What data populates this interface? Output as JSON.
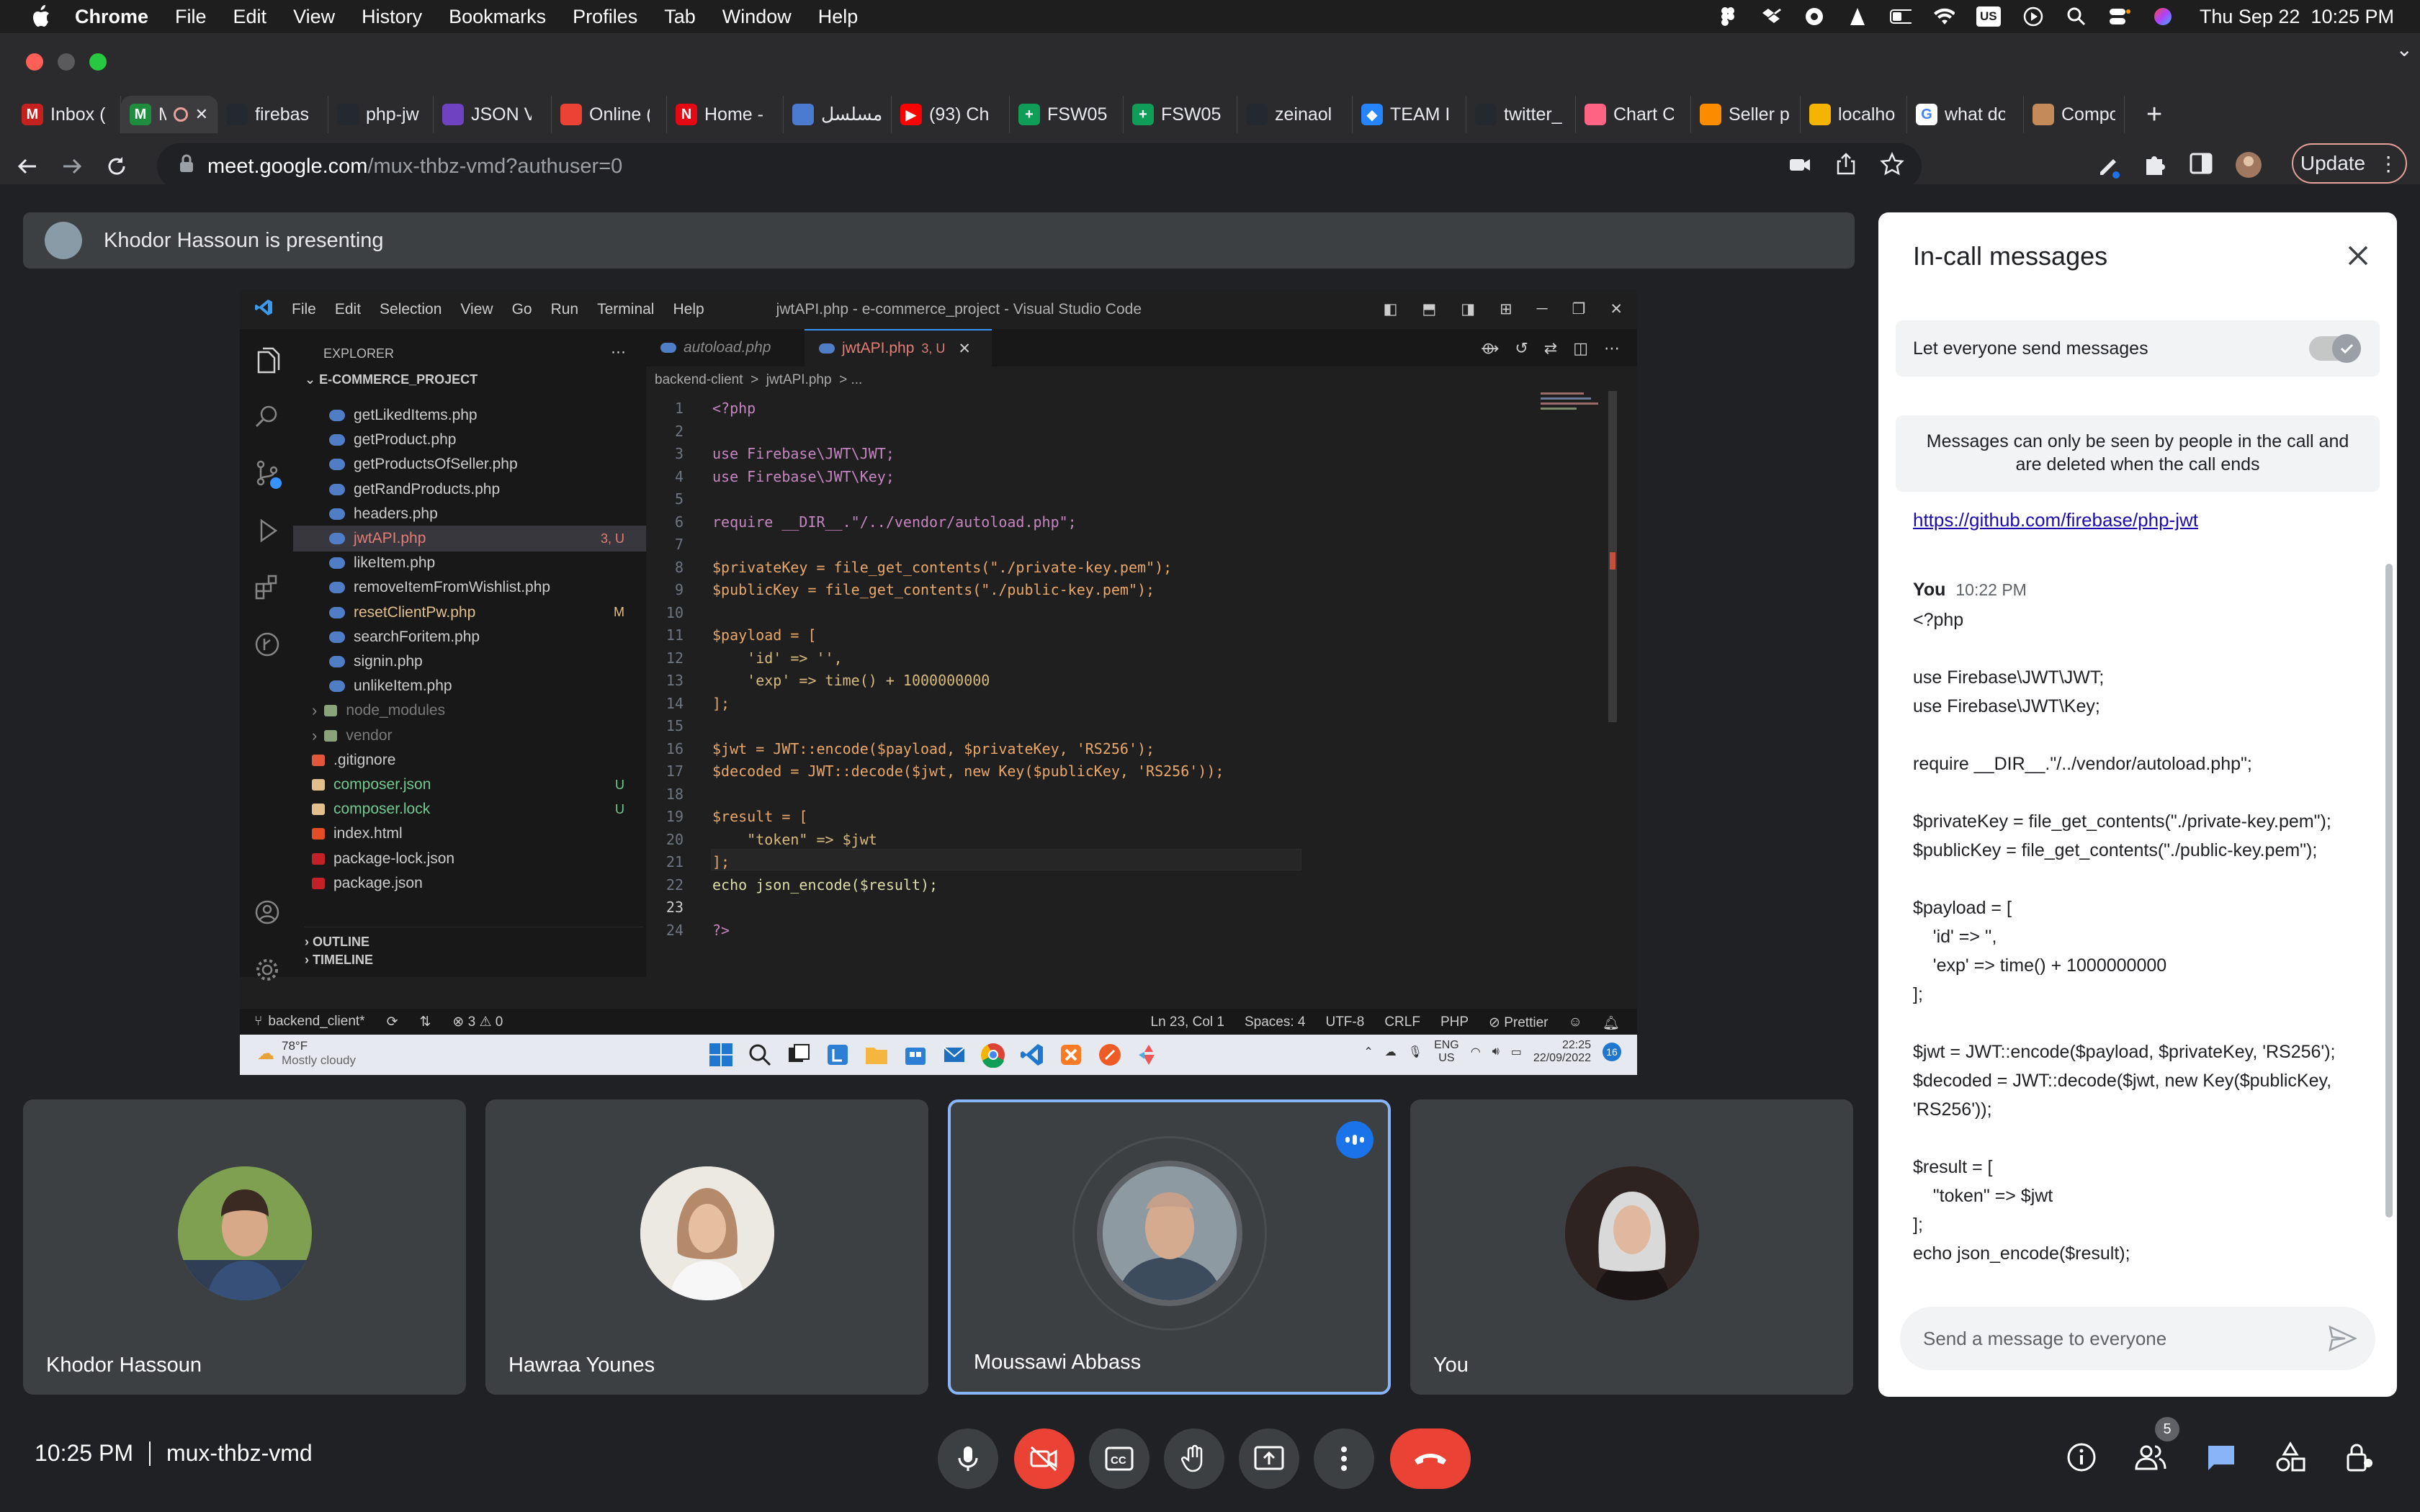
{
  "menubar": {
    "app": "Chrome",
    "items": [
      "File",
      "Edit",
      "View",
      "History",
      "Bookmarks",
      "Profiles",
      "Tab",
      "Window",
      "Help"
    ],
    "clock": "Thu Sep 22  10:25 PM",
    "input_source": "US"
  },
  "tabs": [
    {
      "label": "Inbox (",
      "fav": "M",
      "color": "#c5221f"
    },
    {
      "label": "M",
      "fav": "M",
      "color": "#1e8e3e",
      "active": true
    },
    {
      "label": "firebas",
      "fav": "",
      "color": "#24292f"
    },
    {
      "label": "php-jw",
      "fav": "",
      "color": "#24292f"
    },
    {
      "label": "JSON V",
      "fav": "",
      "color": "#6f42c1"
    },
    {
      "label": "Online (",
      "fav": "",
      "color": "#ea4335"
    },
    {
      "label": "Home -",
      "fav": "N",
      "color": "#e50914"
    },
    {
      "label": "مسلسل",
      "fav": "",
      "color": "#4a7bd0"
    },
    {
      "label": "(93) Ch",
      "fav": "▶",
      "color": "#ff0000"
    },
    {
      "label": "FSW05",
      "fav": "+",
      "color": "#0f9d58"
    },
    {
      "label": "FSW05",
      "fav": "+",
      "color": "#0f9d58"
    },
    {
      "label": "zeinaol",
      "fav": "",
      "color": "#24292f"
    },
    {
      "label": "TEAM I",
      "fav": "◆",
      "color": "#2684ff"
    },
    {
      "label": "twitter_",
      "fav": "",
      "color": "#24292f"
    },
    {
      "label": "Chart C",
      "fav": "",
      "color": "#ff6384"
    },
    {
      "label": "Seller p",
      "fav": "",
      "color": "#fb8c00"
    },
    {
      "label": "localho",
      "fav": "",
      "color": "#f4b400"
    },
    {
      "label": "what do",
      "fav": "G",
      "color": "#ffffff"
    },
    {
      "label": "Compo",
      "fav": "",
      "color": "#c58a5a"
    }
  ],
  "address": {
    "host": "meet.google.com",
    "path": "/mux-thbz-vmd?authuser=0"
  },
  "toolbar": {
    "update_label": "Update"
  },
  "presenting": {
    "text": "Khodor Hassoun is presenting"
  },
  "vscode": {
    "menus": [
      "File",
      "Edit",
      "Selection",
      "View",
      "Go",
      "Run",
      "Terminal",
      "Help"
    ],
    "window_title": "jwtAPI.php - e-commerce_project - Visual Studio Code",
    "explorer_label": "EXPLORER",
    "project": "E-COMMERCE_PROJECT",
    "files": [
      {
        "name": "getLikedItems.php",
        "type": "php"
      },
      {
        "name": "getProduct.php",
        "type": "php"
      },
      {
        "name": "getProductsOfSeller.php",
        "type": "php"
      },
      {
        "name": "getRandProducts.php",
        "type": "php"
      },
      {
        "name": "headers.php",
        "type": "php"
      },
      {
        "name": "jwtAPI.php",
        "type": "php",
        "badge": "3, U",
        "color": "#e37d77",
        "selected": true
      },
      {
        "name": "likeItem.php",
        "type": "php"
      },
      {
        "name": "removeItemFromWishlist.php",
        "type": "php"
      },
      {
        "name": "resetClientPw.php",
        "type": "php",
        "badge": "M",
        "color": "#e2c08d"
      },
      {
        "name": "searchForitem.php",
        "type": "php"
      },
      {
        "name": "signin.php",
        "type": "php"
      },
      {
        "name": "unlikeItem.php",
        "type": "php"
      },
      {
        "name": "node_modules",
        "type": "folder",
        "color": "#7a7a7a",
        "chev": true
      },
      {
        "name": "vendor",
        "type": "folder",
        "color": "#7a7a7a",
        "chev": true
      },
      {
        "name": ".gitignore",
        "type": "git"
      },
      {
        "name": "composer.json",
        "type": "json",
        "badge": "U",
        "color": "#73c991"
      },
      {
        "name": "composer.lock",
        "type": "json",
        "badge": "U",
        "color": "#73c991"
      },
      {
        "name": "index.html",
        "type": "html"
      },
      {
        "name": "package-lock.json",
        "type": "npm"
      },
      {
        "name": "package.json",
        "type": "npm"
      }
    ],
    "outline_label": "OUTLINE",
    "timeline_label": "TIMELINE",
    "tab1": "autoload.php",
    "tab2": "jwtAPI.php",
    "tab2_badge": "3, U",
    "breadcrumb": "backend-client  >  jwtAPI.php  > ...",
    "code": [
      "<?php",
      "",
      "use Firebase\\JWT\\JWT;",
      "use Firebase\\JWT\\Key;",
      "",
      "require __DIR__.\"/../vendor/autoload.php\";",
      "",
      "$privateKey = file_get_contents(\"./private-key.pem\");",
      "$publicKey = file_get_contents(\"./public-key.pem\");",
      "",
      "$payload = [",
      "    'id' => '',",
      "    'exp' => time() + 1000000000",
      "];",
      "",
      "$jwt = JWT::encode($payload, $privateKey, 'RS256');",
      "$decoded = JWT::decode($jwt, new Key($publicKey, 'RS256'));",
      "",
      "$result = [",
      "    \"token\" => $jwt",
      "];",
      "echo json_encode($result);",
      "",
      "?>"
    ],
    "status": {
      "branch": "backend_client*",
      "problems": "⊗ 3 ⚠ 0",
      "position": "Ln 23, Col 1",
      "spaces": "Spaces: 4",
      "encoding": "UTF-8",
      "eol": "CRLF",
      "lang": "PHP",
      "prettier": "Prettier"
    },
    "taskbar": {
      "temp": "78°F",
      "weather": "Mostly cloudy",
      "lang": "ENG",
      "region": "US",
      "time": "22:25",
      "date": "22/09/2022",
      "notif": "16"
    }
  },
  "participants": [
    {
      "name": "Khodor Hassoun",
      "bg": "#6b8f3e"
    },
    {
      "name": "Hawraa Younes",
      "bg": "#e8e2da"
    },
    {
      "name": "Moussawi Abbass",
      "bg": "#7e8a93",
      "speaking": true
    },
    {
      "name": "You",
      "bg": "#3b2d2a"
    }
  ],
  "bottom": {
    "time": "10:25 PM",
    "code": "mux-thbz-vmd",
    "people_count": "5"
  },
  "chat": {
    "title": "In-call messages",
    "toggle_label": "Let everyone send messages",
    "notice": "Messages can only be seen by people in the call and are deleted when the call ends",
    "link": "https://github.com/firebase/php-jwt",
    "sender": "You",
    "time": "10:22 PM",
    "message": "<?php\n\nuse Firebase\\JWT\\JWT;\nuse Firebase\\JWT\\Key;\n\nrequire __DIR__.\"/../vendor/autoload.php\";\n\n$privateKey = file_get_contents(\"./private-key.pem\");\n$publicKey = file_get_contents(\"./public-key.pem\");\n\n$payload = [\n    'id' => '',\n    'exp' => time() + 1000000000\n];\n\n$jwt = JWT::encode($payload, $privateKey, 'RS256');\n$decoded = JWT::decode($jwt, new Key($publicKey, 'RS256'));\n\n$result = [\n    \"token\" => $jwt\n];\necho json_encode($result);",
    "input_placeholder": "Send a message to everyone"
  },
  "colors": {
    "accent": "#8ab4f8",
    "end_call": "#ea4335",
    "speaking_border": "#8ab4f8"
  }
}
